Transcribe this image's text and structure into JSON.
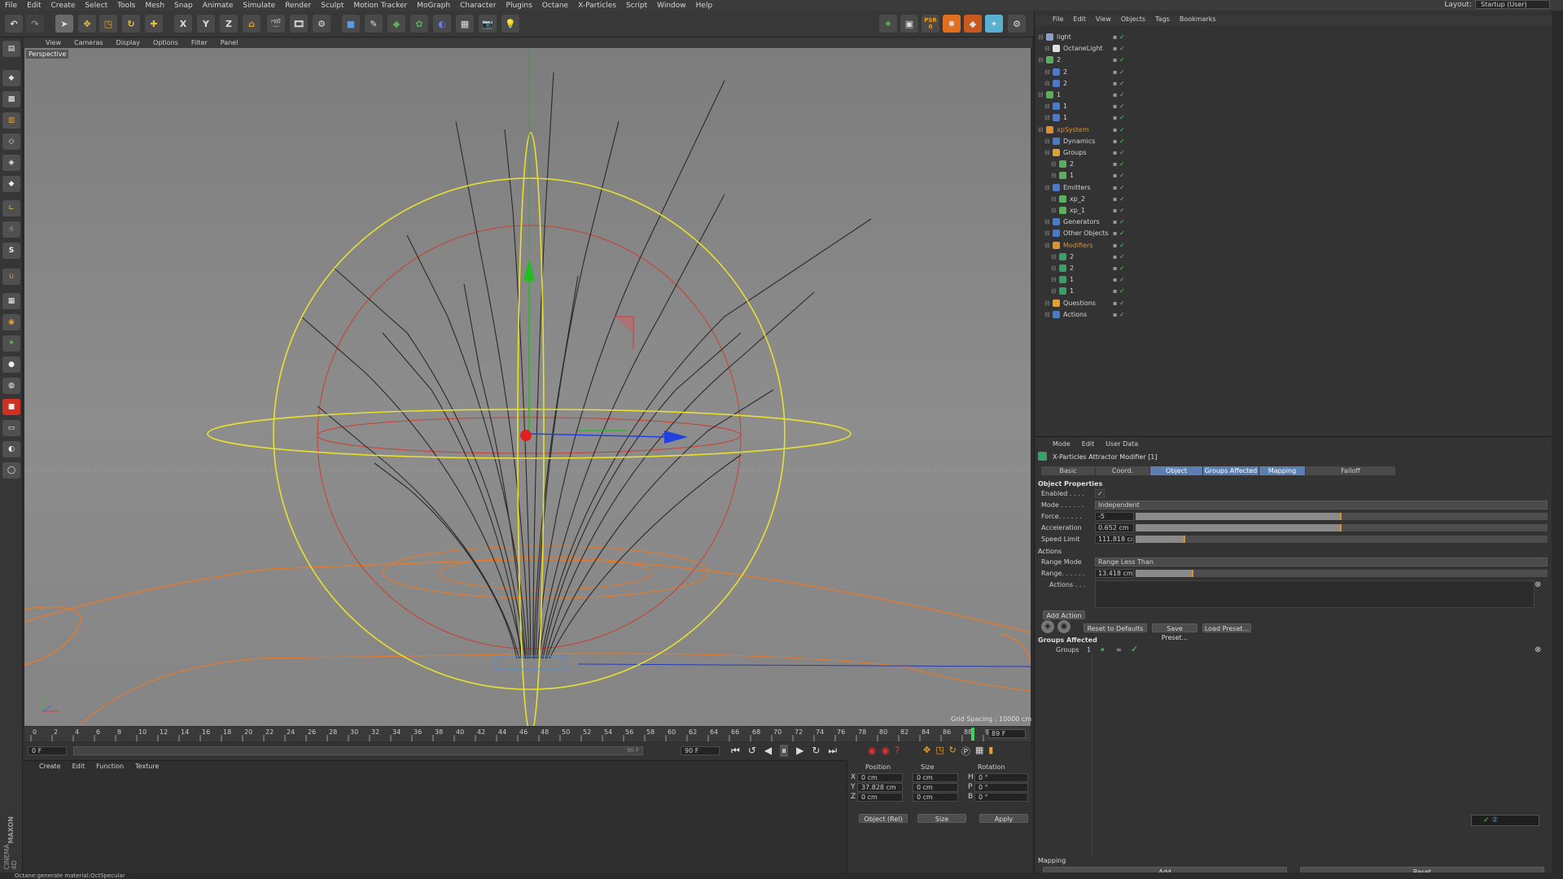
{
  "menu": [
    "File",
    "Edit",
    "Create",
    "Select",
    "Tools",
    "Mesh",
    "Snap",
    "Animate",
    "Simulate",
    "Render",
    "Sculpt",
    "Motion Tracker",
    "MoGraph",
    "Character",
    "Plugins",
    "Octane",
    "X-Particles",
    "Script",
    "Window",
    "Help"
  ],
  "layout": {
    "label": "Layout:",
    "value": "Startup (User)"
  },
  "toolbar": {
    "x": "X",
    "y": "Y",
    "z": "Z",
    "psr": "PSR",
    "psr_count": "0"
  },
  "viewport_menu": [
    "View",
    "Cameras",
    "Display",
    "Options",
    "Filter",
    "Panel"
  ],
  "viewport": {
    "label": "Perspective",
    "grid_spacing": "Grid Spacing : 10000 cm"
  },
  "timeline": {
    "ticks": [
      "0",
      "2",
      "4",
      "6",
      "8",
      "10",
      "12",
      "14",
      "16",
      "18",
      "20",
      "22",
      "24",
      "26",
      "28",
      "30",
      "32",
      "34",
      "36",
      "38",
      "40",
      "42",
      "44",
      "46",
      "48",
      "50",
      "52",
      "54",
      "56",
      "58",
      "60",
      "62",
      "64",
      "66",
      "68",
      "70",
      "72",
      "74",
      "76",
      "78",
      "80",
      "82",
      "84",
      "86",
      "88",
      "90"
    ],
    "current": "89 F",
    "start": "0 F",
    "end_range": "90 F",
    "end": "90 F",
    "playhead_frame": 89,
    "max_frame": 90
  },
  "materials": {
    "menu": [
      "Create",
      "Edit",
      "Function",
      "Texture"
    ]
  },
  "coords": {
    "headers": [
      "Position",
      "Size",
      "Rotation"
    ],
    "rows": [
      {
        "axis": "X",
        "pos": "0 cm",
        "size": "0 cm",
        "rlabel": "H",
        "rot": "0 °"
      },
      {
        "axis": "Y",
        "pos": "37.828 cm",
        "size": "0 cm",
        "rlabel": "P",
        "rot": "0 °"
      },
      {
        "axis": "Z",
        "pos": "0 cm",
        "size": "0 cm",
        "rlabel": "B",
        "rot": "0 °"
      }
    ],
    "mode": "Object (Rel)",
    "size_mode": "Size",
    "apply": "Apply"
  },
  "status": "Octane:generate material:OctSpecular",
  "brand": {
    "maxon": "MAXON",
    "c4d": "CINEMA 4D"
  },
  "objects": {
    "menu": [
      "File",
      "Edit",
      "View",
      "Objects",
      "Tags",
      "Bookmarks"
    ],
    "rows": [
      {
        "name": "light",
        "indent": 0,
        "color": "#8aa0c8"
      },
      {
        "name": "OctaneLight",
        "indent": 1,
        "color": "#e0e0e0"
      },
      {
        "name": "2",
        "indent": 0,
        "color": "#5ab05a"
      },
      {
        "name": "2",
        "indent": 1,
        "color": "#4a7ac8"
      },
      {
        "name": "2",
        "indent": 1,
        "color": "#4a7ac8"
      },
      {
        "name": "1",
        "indent": 0,
        "color": "#5ab05a"
      },
      {
        "name": "1",
        "indent": 1,
        "color": "#4a7ac8"
      },
      {
        "name": "1",
        "indent": 1,
        "color": "#4a7ac8"
      },
      {
        "name": "xpSystem",
        "indent": 0,
        "color": "#e09030",
        "highlight": true
      },
      {
        "name": "Dynamics",
        "indent": 1,
        "color": "#4a7ac8"
      },
      {
        "name": "Groups",
        "indent": 1,
        "color": "#e0a030"
      },
      {
        "name": "2",
        "indent": 2,
        "color": "#5ab05a"
      },
      {
        "name": "1",
        "indent": 2,
        "color": "#5ab05a"
      },
      {
        "name": "Emitters",
        "indent": 1,
        "color": "#4a7ac8"
      },
      {
        "name": "xp_2",
        "indent": 2,
        "color": "#5ab05a"
      },
      {
        "name": "xp_1",
        "indent": 2,
        "color": "#5ab05a"
      },
      {
        "name": "Generators",
        "indent": 1,
        "color": "#4a7ac8"
      },
      {
        "name": "Other Objects",
        "indent": 1,
        "color": "#4a7ac8"
      },
      {
        "name": "Modifiers",
        "indent": 1,
        "color": "#e09030",
        "highlight": true
      },
      {
        "name": "2",
        "indent": 2,
        "color": "#3aa06a"
      },
      {
        "name": "2",
        "indent": 2,
        "color": "#3aa06a"
      },
      {
        "name": "1",
        "indent": 2,
        "color": "#3aa06a"
      },
      {
        "name": "1",
        "indent": 2,
        "color": "#3aa06a"
      },
      {
        "name": "Questions",
        "indent": 1,
        "color": "#e0a030"
      },
      {
        "name": "Actions",
        "indent": 1,
        "color": "#4a7ac8"
      }
    ]
  },
  "attributes": {
    "menu": [
      "Mode",
      "Edit",
      "User Data"
    ],
    "title": "X-Particles Attractor Modifier [1]",
    "tabs": [
      "Basic",
      "Coord.",
      "Object",
      "Groups Affected",
      "Mapping",
      "Falloff"
    ],
    "active_tabs": [
      2,
      3,
      4
    ],
    "section_object": "Object Properties",
    "enabled_label": "Enabled . . . .",
    "enabled_value": "✓",
    "mode_label": "Mode . . . . . .",
    "mode_value": "Independent",
    "force_label": "Force. . . . . .",
    "force_value": "-5",
    "force_fill": 0.5,
    "accel_label": "Acceleration",
    "accel_value": "0.652 cm",
    "accel_fill": 0.5,
    "speed_label": "Speed Limit",
    "speed_value": "111.818 cı",
    "speed_fill": 0.12,
    "section_actions": "Actions",
    "range_mode_label": "Range Mode",
    "range_mode_value": "Range Less Than",
    "range_label": "Range. . . . . .",
    "range_value": "13.418 cm",
    "range_fill": 0.14,
    "actions_list_label": "Actions . . .",
    "add_action": "Add Action",
    "reset": "Reset to Defaults",
    "save_preset": "Save Preset...",
    "load_preset": "Load Preset...",
    "groups_affected": "Groups Affected",
    "groups_label": "Groups",
    "groups_value": "1",
    "mapping": "Mapping",
    "add": "Add",
    "reset_btn": "Reset"
  },
  "colors": {
    "accent": "#5b7fb3",
    "orange": "#e0902a",
    "yellow": "#e8e030"
  }
}
